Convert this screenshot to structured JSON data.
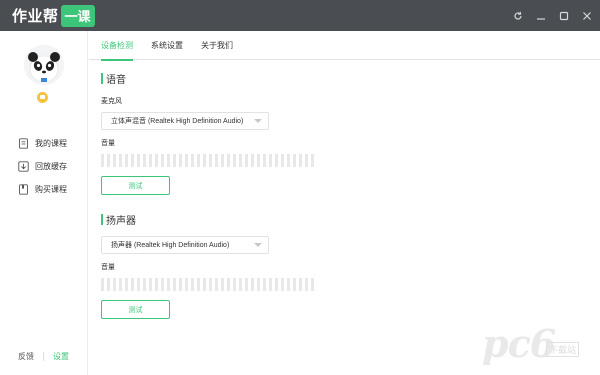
{
  "app": {
    "logo_text": "作业帮",
    "logo_badge": "一课"
  },
  "window_controls": [
    {
      "name": "refresh-icon"
    },
    {
      "name": "minimize-icon"
    },
    {
      "name": "maximize-icon"
    },
    {
      "name": "close-icon"
    }
  ],
  "sidebar": {
    "avatar": "panda-avatar",
    "items": [
      {
        "label": "我的课程",
        "icon": "document-icon"
      },
      {
        "label": "回放缓存",
        "icon": "download-icon"
      },
      {
        "label": "购买课程",
        "icon": "bookmark-icon"
      }
    ],
    "footer": {
      "feedback": "反馈",
      "settings": "设置"
    }
  },
  "tabs": [
    {
      "label": "设备检测",
      "active": true
    },
    {
      "label": "系统设置",
      "active": false
    },
    {
      "label": "关于我们",
      "active": false
    }
  ],
  "voice": {
    "title": "语音",
    "mic_label": "麦克风",
    "mic_device": "立体声混音 (Realtek High Definition Audio)",
    "volume_label": "音量",
    "test_button": "测试"
  },
  "speaker": {
    "title": "扬声器",
    "device": "扬声器 (Realtek High Definition Audio)",
    "volume_label": "音量",
    "test_button": "测试"
  },
  "watermark": {
    "big": "pc6",
    "small": "下载站"
  },
  "colors": {
    "accent": "#3dc57a",
    "titlebar": "#4a4d52"
  }
}
